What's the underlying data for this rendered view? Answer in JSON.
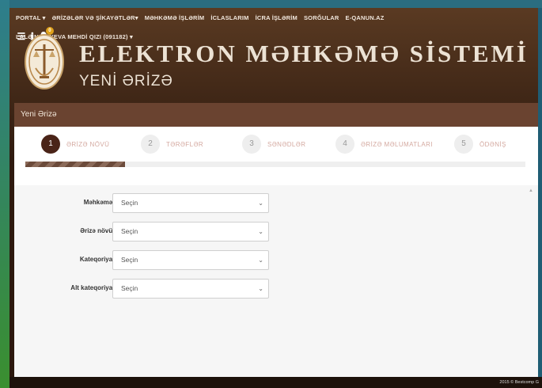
{
  "topnav": {
    "items": [
      "PORTAL ▾",
      "ƏRİZƏLƏR VƏ ŞİKAYƏTLƏR▾",
      "MƏHKƏMƏ İŞLƏRİM",
      "İCLASLARIM",
      "İCRA İŞLƏRİM",
      "SORĞULAR",
      "E-QANUN.AZ"
    ],
    "user": "LALƏ NAĞIYEVA MEHDİ QIZI (091182) ▾",
    "notification_count": "0",
    "icons": [
      "sliders-icon",
      "info-icon",
      "bell-icon"
    ]
  },
  "header": {
    "title": "ELEKTRON MƏHKƏMƏ SİSTEMİ",
    "subtitle": "YENİ ƏRİZƏ"
  },
  "panel": {
    "title": "Yeni Ərizə",
    "steps": [
      {
        "num": "1",
        "label": "ƏRİZƏ NÖVÜ",
        "active": true
      },
      {
        "num": "2",
        "label": "TƏRƏFLƏR",
        "active": false
      },
      {
        "num": "3",
        "label": "SƏNƏDLƏR",
        "active": false
      },
      {
        "num": "4",
        "label": "ƏRİZƏ MƏLUMATLARI",
        "active": false
      },
      {
        "num": "5",
        "label": "ÖDƏNİŞ",
        "active": false
      }
    ],
    "progress": 0.2
  },
  "form": {
    "fields": [
      {
        "label": "Məhkəmə:",
        "value": "Seçin"
      },
      {
        "label": "Ərizə növü:",
        "value": "Seçin"
      },
      {
        "label": "Kateqoriya:",
        "value": "Seçin"
      },
      {
        "label": "Alt kateqoriya:",
        "value": "Seçin"
      }
    ]
  },
  "footer": {
    "text": "2015 © Bestcomp G"
  },
  "colors": {
    "brand_brown": "#6a4330",
    "required": "#d40000",
    "active_step": "#4a2418"
  }
}
